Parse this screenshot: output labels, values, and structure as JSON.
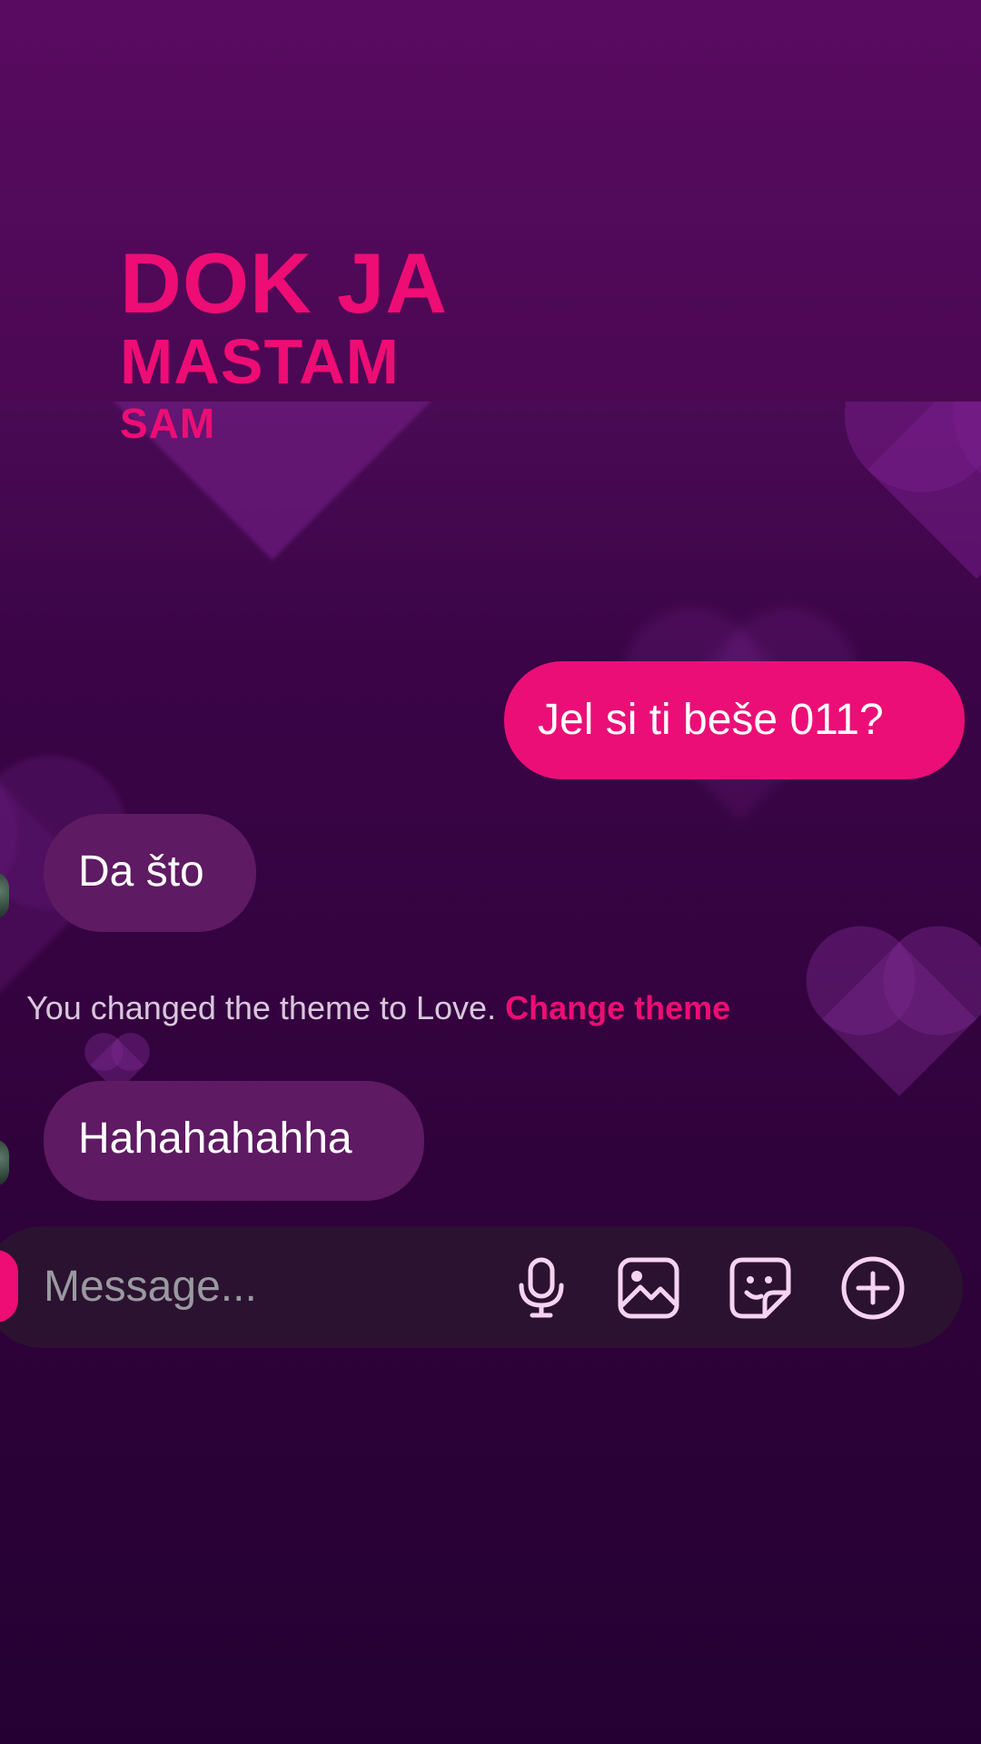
{
  "overlay_title": {
    "line1": "DOK JA",
    "line2": "MASTAM",
    "line3": "SAM"
  },
  "messages": [
    {
      "direction": "outgoing",
      "text": "Jel si ti beše 011?"
    },
    {
      "direction": "incoming",
      "text": "Da što"
    },
    {
      "direction": "incoming",
      "text": "Hahahahahha"
    }
  ],
  "system_message": {
    "text": "You changed the theme to Love.",
    "link": "Change theme"
  },
  "composer": {
    "placeholder": "Message...",
    "icons": [
      "microphone-icon",
      "image-icon",
      "sticker-icon",
      "plus-icon"
    ]
  },
  "colors": {
    "accent": "#ee0d74",
    "outgoing_bubble": "#ec0e77",
    "incoming_bubble": "#5e1a62",
    "composer_bg": "#2b1230",
    "icon_tint": "#f6d3f0"
  }
}
